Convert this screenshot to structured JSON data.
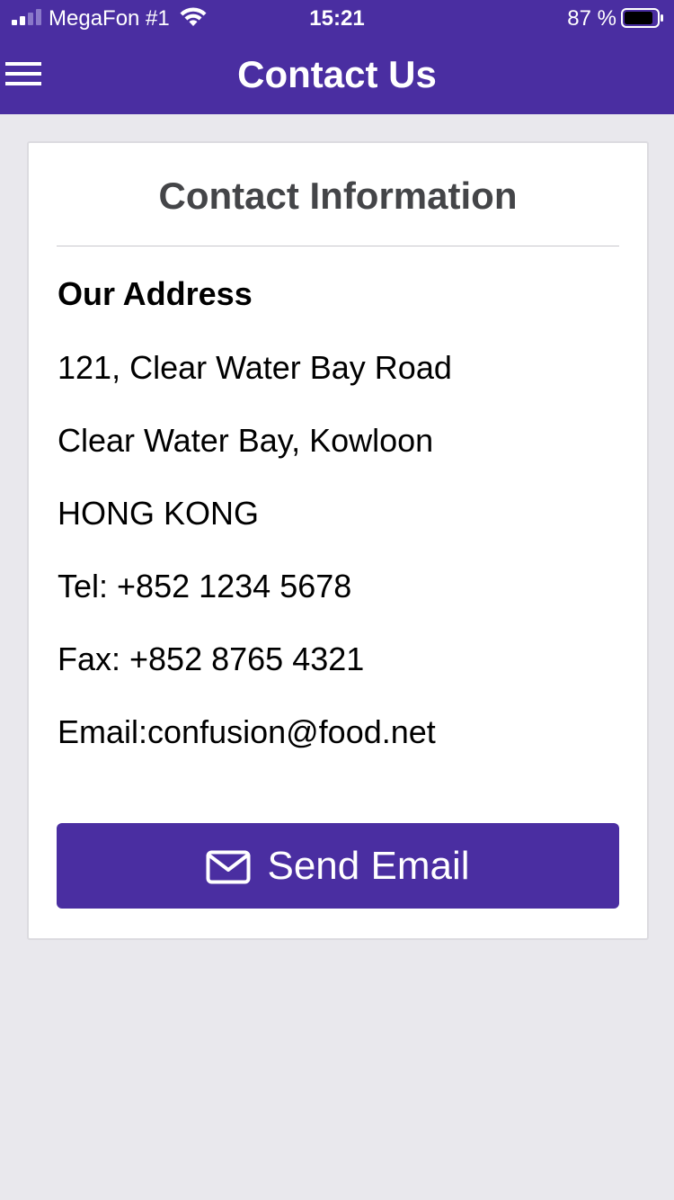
{
  "status_bar": {
    "carrier": "MegaFon #1",
    "time": "15:21",
    "battery_percent": "87 %",
    "icons": [
      "signal-icon",
      "wifi-icon",
      "battery-icon"
    ]
  },
  "nav": {
    "menu_icon": "hamburger-menu-icon",
    "title": "Contact Us"
  },
  "card": {
    "title": "Contact Information",
    "address_heading": "Our Address",
    "lines": [
      "121, Clear Water Bay Road",
      "Clear Water Bay, Kowloon",
      "HONG KONG",
      "Tel: +852 1234 5678",
      "Fax: +852 8765 4321",
      "Email:confusion@food.net"
    ],
    "send_button": {
      "icon": "envelope-icon",
      "label": "Send Email"
    }
  },
  "colors": {
    "primary": "#4a2ea1",
    "background": "#e9e8ed",
    "card_background": "#ffffff",
    "title_text": "#444548"
  }
}
